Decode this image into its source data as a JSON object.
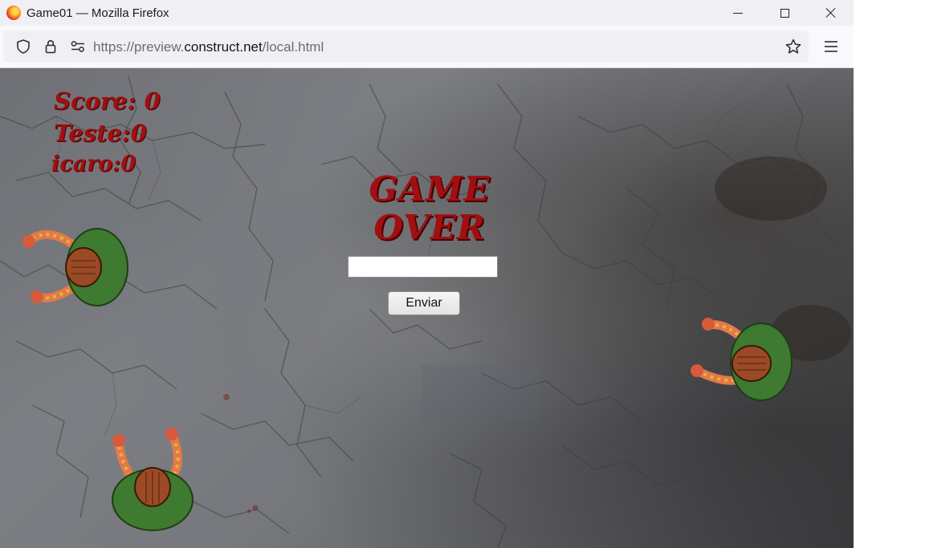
{
  "window": {
    "title": "Game01 — Mozilla Firefox"
  },
  "navbar": {
    "url_prefix": "https://preview.",
    "url_domain": "construct.net",
    "url_path": "/local.html"
  },
  "icons": {
    "app": "firefox-logo",
    "minimize": "minimize-icon",
    "maximize": "maximize-icon",
    "close": "close-icon",
    "tracking": "shield-icon",
    "security": "lock-icon",
    "permissions": "permissions-icon",
    "bookmark": "star-icon",
    "menu": "hamburger-menu-icon"
  },
  "game": {
    "hud": {
      "score": "Score: 0",
      "teste": "Teste:0",
      "icaro": "icaro:0"
    },
    "gameover_line1": "GAME",
    "gameover_line2": "OVER",
    "name_input_value": "",
    "send_label": "Enviar"
  },
  "colors": {
    "hud_text": "#a10f10",
    "titlebar_bg": "#f0f0f4",
    "zombie_shirt": "#3e7a2f",
    "zombie_skin": "#e07a4a"
  }
}
